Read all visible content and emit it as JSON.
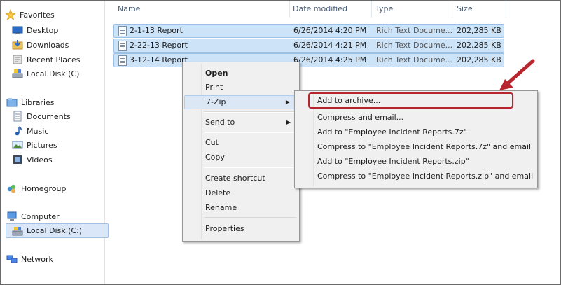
{
  "sidebar": {
    "favorites": "Favorites",
    "desktop": "Desktop",
    "downloads": "Downloads",
    "recent_places": "Recent Places",
    "local_disk_c": "Local Disk (C)",
    "libraries": "Libraries",
    "documents": "Documents",
    "music": "Music",
    "pictures": "Pictures",
    "videos": "Videos",
    "homegroup": "Homegroup",
    "computer": "Computer",
    "local_disk_c2": "Local Disk (C:)",
    "network": "Network"
  },
  "columns": {
    "name": "Name",
    "date": "Date modified",
    "type": "Type",
    "size": "Size"
  },
  "files": [
    {
      "name": "2-1-13 Report",
      "date": "6/26/2014 4:20 PM",
      "type": "Rich Text Docume...",
      "size": "202,285 KB"
    },
    {
      "name": "2-22-13 Report",
      "date": "6/26/2014 4:21 PM",
      "type": "Rich Text Docume...",
      "size": "202,285 KB"
    },
    {
      "name": "3-12-14 Report",
      "date": "6/26/2014 4:25 PM",
      "type": "Rich Text Docume...",
      "size": "202,285 KB"
    }
  ],
  "context_menu": {
    "open": "Open",
    "print": "Print",
    "seven_zip": "7-Zip",
    "send_to": "Send to",
    "cut": "Cut",
    "copy": "Copy",
    "create_shortcut": "Create shortcut",
    "delete": "Delete",
    "rename": "Rename",
    "properties": "Properties",
    "submenu_arrow": "▶"
  },
  "zip_submenu": [
    "Add to archive...",
    "Compress and email...",
    "Add to \"Employee Incident Reports.7z\"",
    "Compress to \"Employee Incident Reports.7z\" and email",
    "Add to \"Employee Incident Reports.zip\"",
    "Compress to \"Employee Incident Reports.zip\" and email"
  ],
  "colors": {
    "callout": "#b7262e",
    "selection": "#cde3f8",
    "arrow": "#b7262e"
  }
}
